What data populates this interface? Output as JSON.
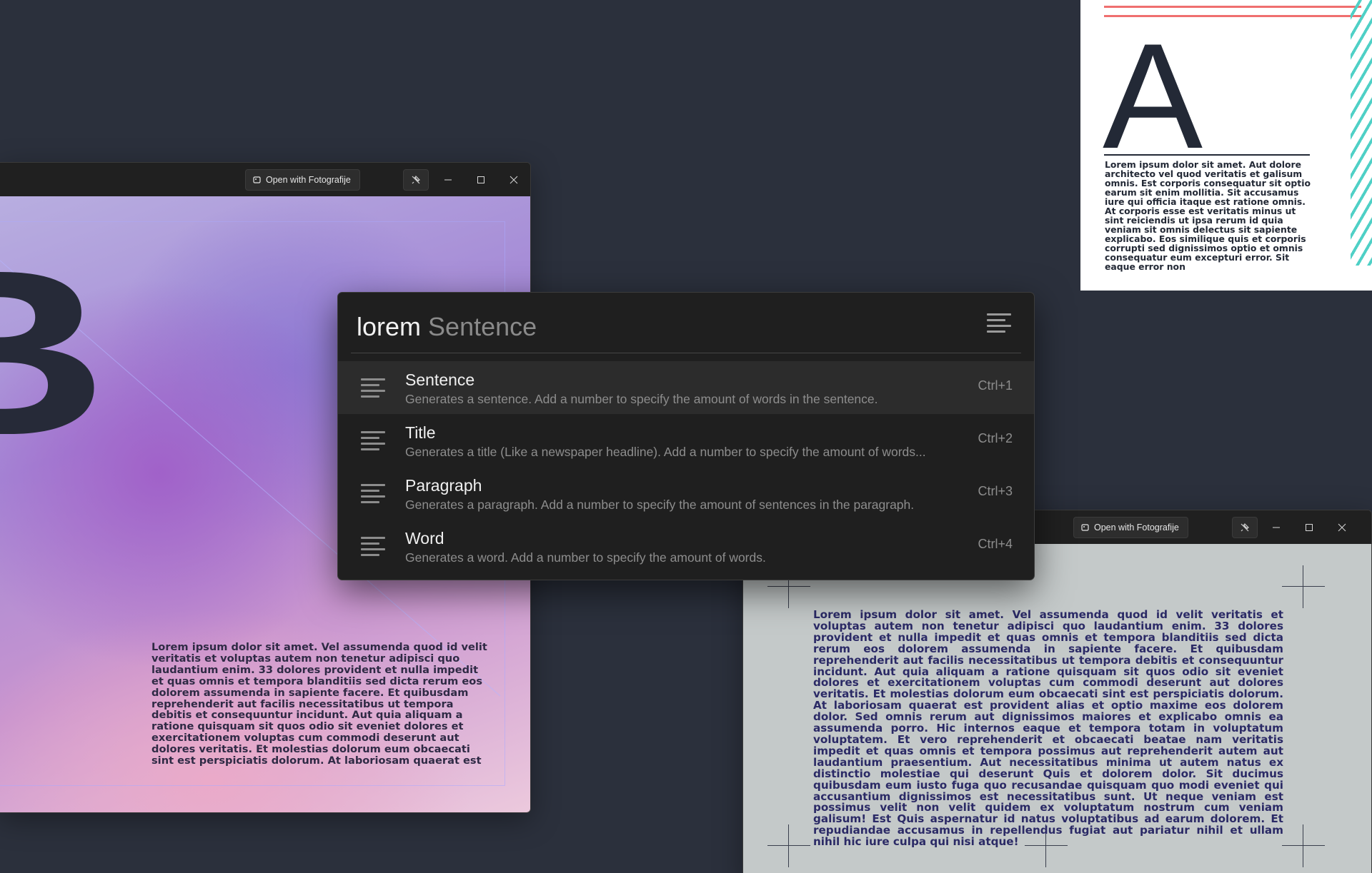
{
  "launcher": {
    "query_keyword": "lorem",
    "query_suggestion": "Sentence",
    "results": [
      {
        "title": "Sentence",
        "description": "Generates a sentence. Add a number to specify the amount of words in the sentence.",
        "shortcut": "Ctrl+1",
        "selected": true
      },
      {
        "title": "Title",
        "description": "Generates a title (Like a newspaper headline). Add a number to specify the amount of words...",
        "shortcut": "Ctrl+2",
        "selected": false
      },
      {
        "title": "Paragraph",
        "description": "Generates a paragraph. Add a number to specify the amount of sentences in the paragraph.",
        "shortcut": "Ctrl+3",
        "selected": false
      },
      {
        "title": "Word",
        "description": "Generates a word. Add a number to specify the amount of words.",
        "shortcut": "Ctrl+4",
        "selected": false
      }
    ]
  },
  "left_window": {
    "open_button_label": "Open with Fotografije",
    "poster_letter": "B",
    "poster_text": "Lorem ipsum dolor sit amet. Vel assumenda quod id velit veritatis et voluptas autem non tenetur adipisci quo laudantium enim. 33 dolores provident et nulla impedit et quas omnis et tempora blanditiis sed dicta rerum eos dolorem assumenda in sapiente facere. Et quibusdam reprehenderit aut facilis necessitatibus ut tempora debitis et consequuntur incidunt. Aut quia aliquam a ratione quisquam sit quos odio sit eveniet dolores et exercitationem voluptas cum commodi deserunt aut dolores veritatis. Et molestias dolorum eum obcaecati sint est perspiciatis dolorum. At laboriosam quaerat est"
  },
  "card_a": {
    "letter": "A",
    "text": "Lorem ipsum dolor sit amet. Aut dolore architecto vel quod veritatis et galisum omnis. Est corporis consequatur sit optio earum sit enim mollitia. Sit accusamus iure qui officia itaque est ratione omnis. At corporis esse est veritatis minus ut sint reiciendis ut ipsa rerum id quia veniam sit omnis delectus sit sapiente explicabo. Eos similique quis et corporis corrupti sed dignissimos optio et omnis consequatur eum excepturi error. Sit eaque error non"
  },
  "right_window": {
    "open_button_label": "Open with Fotografije",
    "poster_text": "Lorem ipsum dolor sit amet. Vel assumenda quod id velit veritatis et voluptas autem non tenetur adipisci quo laudantium enim. 33 dolores provident et nulla impedit et quas omnis et tempora blanditiis sed dicta rerum eos dolorem assumenda in sapiente facere. Et quibusdam reprehenderit aut facilis necessitatibus ut tempora debitis et consequuntur incidunt. Aut quia aliquam a ratione quisquam sit quos odio sit eveniet dolores et exercitationem voluptas cum commodi deserunt aut dolores veritatis. Et molestias dolorum eum obcaecati sint est perspiciatis dolorum. At laboriosam quaerat est provident alias et optio maxime eos dolorem dolor. Sed omnis rerum aut dignissimos maiores et explicabo omnis ea assumenda porro. Hic internos eaque et tempora totam in voluptatum voluptatem. Et vero reprehenderit et obcaecati beatae nam veritatis impedit et quas omnis et tempora possimus aut reprehenderit autem aut laudantium praesentium. Aut necessitatibus minima ut autem natus ex distinctio molestiae qui deserunt Quis et dolorem dolor. Sit ducimus quibusdam eum iusto fuga quo recusandae quisquam quo modi eveniet qui accusantium dignissimos est necessitatibus sunt. Ut neque veniam est possimus velit non velit quidem ex voluptatum nostrum cum veniam galisum! Est Quis aspernatur id natus voluptatibus ad earum dolorem. Et repudiandae accusamus in repellendus fugiat aut pariatur nihil et ullam nihil hic iure culpa qui nisi atque!"
  },
  "colors": {
    "desktop_bg": "#2b303c",
    "panel_bg": "#1f1f1f",
    "selected_row": "#2c2c2c",
    "accent_teal": "#4fd0c6",
    "accent_red": "#ef6f6f"
  },
  "icons": [
    "lines-icon",
    "menu-icon",
    "image-open-icon",
    "pin-off-icon",
    "minimize-icon",
    "maximize-icon",
    "close-icon"
  ]
}
